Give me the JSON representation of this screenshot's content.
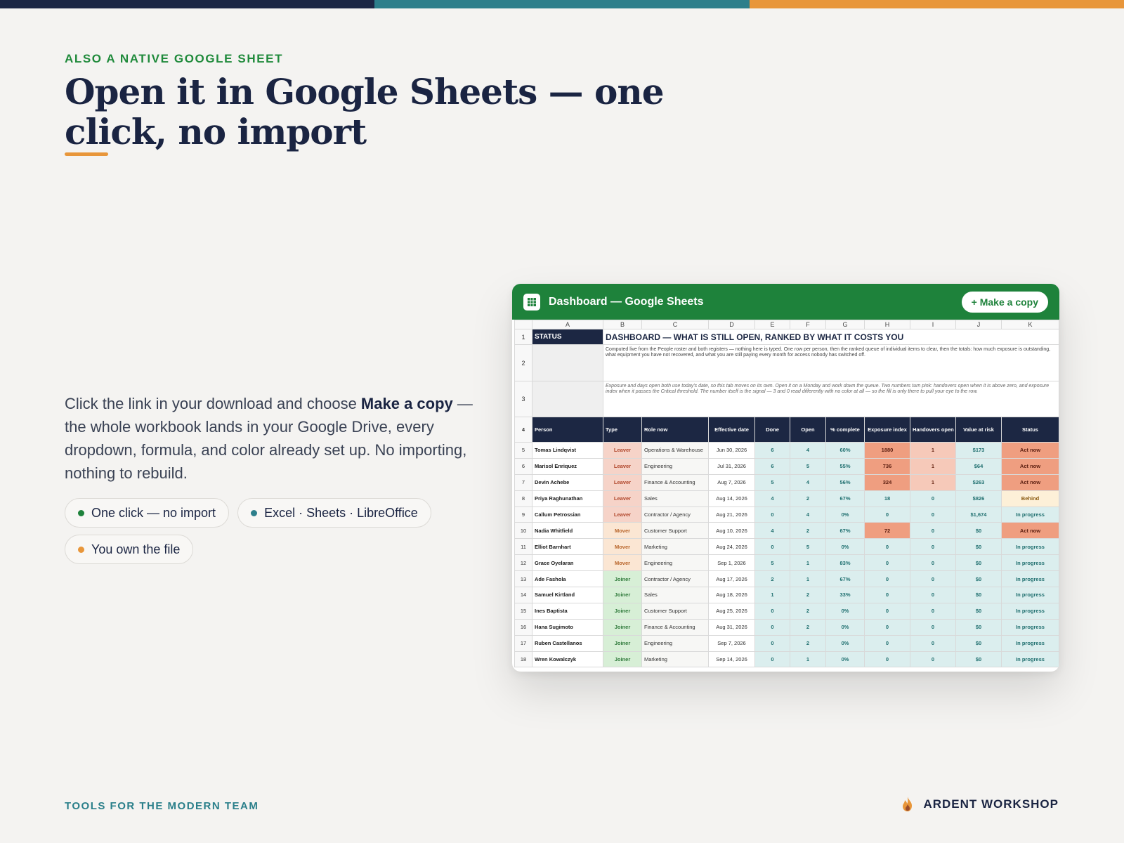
{
  "colors": {
    "bar_navy": "#1c2745",
    "bar_teal": "#2d7f8b",
    "bar_orange": "#e8963a",
    "green": "#1e823b",
    "leaver": "#f6d3c8",
    "mover": "#fbe6d3",
    "joiner": "#d7efd6",
    "hot": "#ef9e80",
    "warm": "#f6c9b9",
    "ok": "#dbeeee",
    "behind": "#fdf0d8"
  },
  "hero": {
    "eyebrow": "ALSO A NATIVE GOOGLE SHEET",
    "headline": "Open it in Google Sheets — one click, no import",
    "body_before": "Click the link in your download and choose ",
    "body_bold": "Make a copy",
    "body_after": " — the whole workbook lands in your Google Drive, every dropdown, formula, and color already set up. No importing, nothing to rebuild."
  },
  "chips": [
    {
      "label": "One click — no import",
      "dot": "#1e823b"
    },
    {
      "label": "Excel · Sheets · LibreOffice",
      "dot": "#2d7f8b"
    },
    {
      "label": "You own the file",
      "dot": "#e8963a"
    }
  ],
  "sheet": {
    "window_title": "Dashboard — Google Sheets",
    "icon": "sheets-grid-icon",
    "copy_button": "+ Make a copy",
    "columns": [
      "A",
      "B",
      "C",
      "D",
      "E",
      "F",
      "G",
      "H",
      "I",
      "J",
      "K"
    ],
    "status_label": "STATUS",
    "title": "DASHBOARD — WHAT IS STILL OPEN, RANKED BY WHAT IT COSTS YOU",
    "description": "Computed live from the People roster and both registers — nothing here is typed. One row per person, then the ranked queue of individual items to clear, then the totals: how much exposure is outstanding, what equipment you have not recovered, and what you are still paying every month for access nobody has switched off.",
    "note": "Exposure and days open both use today's date, so this tab moves on its own. Open it on a Monday and work down the queue. Two numbers turn pink: handovers open when it is above zero, and exposure index when it passes the Critical threshold. The number itself is the signal — 3 and 0 read differently with no color at all — so the fill is only there to pull your eye to the row.",
    "headers": [
      "Person",
      "Type",
      "Role now",
      "Effective date",
      "Done",
      "Open",
      "% complete",
      "Exposure index",
      "Handovers open",
      "Value at risk",
      "Status"
    ],
    "rows": [
      {
        "n": "5",
        "person": "Tomas Lindqvist",
        "type": "Leaver",
        "role": "Operations & Warehouse",
        "date": "Jun 30, 2026",
        "done": "6",
        "open": "4",
        "pct": "60%",
        "exp": "1880",
        "hand": "1",
        "val": "$173",
        "status": "Act now"
      },
      {
        "n": "6",
        "person": "Marisol Enriquez",
        "type": "Leaver",
        "role": "Engineering",
        "date": "Jul 31, 2026",
        "done": "6",
        "open": "5",
        "pct": "55%",
        "exp": "736",
        "hand": "1",
        "val": "$64",
        "status": "Act now"
      },
      {
        "n": "7",
        "person": "Devin Achebe",
        "type": "Leaver",
        "role": "Finance & Accounting",
        "date": "Aug 7, 2026",
        "done": "5",
        "open": "4",
        "pct": "56%",
        "exp": "324",
        "hand": "1",
        "val": "$263",
        "status": "Act now"
      },
      {
        "n": "8",
        "person": "Priya Raghunathan",
        "type": "Leaver",
        "role": "Sales",
        "date": "Aug 14, 2026",
        "done": "4",
        "open": "2",
        "pct": "67%",
        "exp": "18",
        "hand": "0",
        "val": "$826",
        "status": "Behind"
      },
      {
        "n": "9",
        "person": "Callum Petrossian",
        "type": "Leaver",
        "role": "Contractor / Agency",
        "date": "Aug 21, 2026",
        "done": "0",
        "open": "4",
        "pct": "0%",
        "exp": "0",
        "hand": "0",
        "val": "$1,674",
        "status": "In progress"
      },
      {
        "n": "10",
        "person": "Nadia Whitfield",
        "type": "Mover",
        "role": "Customer Support",
        "date": "Aug 10, 2026",
        "done": "4",
        "open": "2",
        "pct": "67%",
        "exp": "72",
        "hand": "0",
        "val": "$0",
        "status": "Act now"
      },
      {
        "n": "11",
        "person": "Elliot Barnhart",
        "type": "Mover",
        "role": "Marketing",
        "date": "Aug 24, 2026",
        "done": "0",
        "open": "5",
        "pct": "0%",
        "exp": "0",
        "hand": "0",
        "val": "$0",
        "status": "In progress"
      },
      {
        "n": "12",
        "person": "Grace Oyelaran",
        "type": "Mover",
        "role": "Engineering",
        "date": "Sep 1, 2026",
        "done": "5",
        "open": "1",
        "pct": "83%",
        "exp": "0",
        "hand": "0",
        "val": "$0",
        "status": "In progress"
      },
      {
        "n": "13",
        "person": "Ade Fashola",
        "type": "Joiner",
        "role": "Contractor / Agency",
        "date": "Aug 17, 2026",
        "done": "2",
        "open": "1",
        "pct": "67%",
        "exp": "0",
        "hand": "0",
        "val": "$0",
        "status": "In progress"
      },
      {
        "n": "14",
        "person": "Samuel Kirtland",
        "type": "Joiner",
        "role": "Sales",
        "date": "Aug 18, 2026",
        "done": "1",
        "open": "2",
        "pct": "33%",
        "exp": "0",
        "hand": "0",
        "val": "$0",
        "status": "In progress"
      },
      {
        "n": "15",
        "person": "Ines Baptista",
        "type": "Joiner",
        "role": "Customer Support",
        "date": "Aug 25, 2026",
        "done": "0",
        "open": "2",
        "pct": "0%",
        "exp": "0",
        "hand": "0",
        "val": "$0",
        "status": "In progress"
      },
      {
        "n": "16",
        "person": "Hana Sugimoto",
        "type": "Joiner",
        "role": "Finance & Accounting",
        "date": "Aug 31, 2026",
        "done": "0",
        "open": "2",
        "pct": "0%",
        "exp": "0",
        "hand": "0",
        "val": "$0",
        "status": "In progress"
      },
      {
        "n": "17",
        "person": "Ruben Castellanos",
        "type": "Joiner",
        "role": "Engineering",
        "date": "Sep 7, 2026",
        "done": "0",
        "open": "2",
        "pct": "0%",
        "exp": "0",
        "hand": "0",
        "val": "$0",
        "status": "In progress"
      },
      {
        "n": "18",
        "person": "Wren Kowalczyk",
        "type": "Joiner",
        "role": "Marketing",
        "date": "Sep 14, 2026",
        "done": "0",
        "open": "1",
        "pct": "0%",
        "exp": "0",
        "hand": "0",
        "val": "$0",
        "status": "In progress"
      }
    ]
  },
  "footer": {
    "left": "TOOLS FOR THE MODERN TEAM",
    "brand": "ARDENT WORKSHOP",
    "brand_icon": "flame-logo-icon"
  }
}
